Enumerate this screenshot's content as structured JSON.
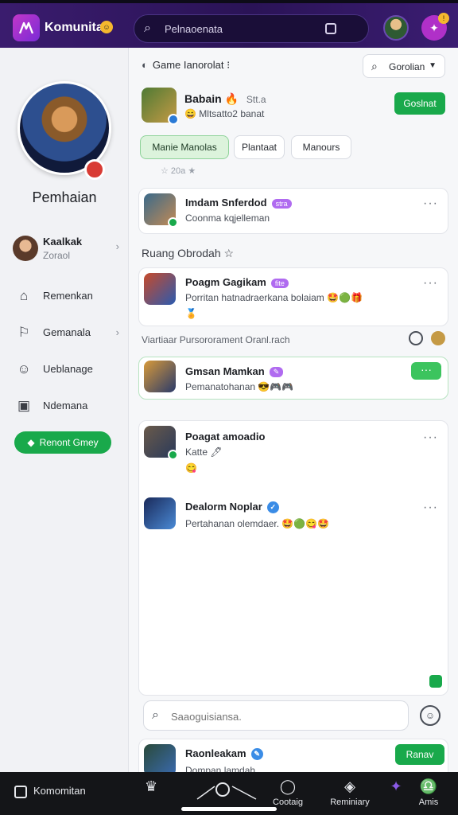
{
  "topbar": {
    "brand": "Komunita",
    "search_text": "Pelnaoenata"
  },
  "sidebar": {
    "profile_name": "Pemhaian",
    "user": {
      "name": "Kaalkak",
      "handle": "Zoraol"
    },
    "nav": [
      {
        "label": "Remenkan",
        "icon": "home-icon",
        "chevron": false
      },
      {
        "label": "Gemanala",
        "icon": "flag-icon",
        "chevron": true
      },
      {
        "label": "Ueblanage",
        "icon": "smile-icon",
        "chevron": false
      },
      {
        "label": "Ndemana",
        "icon": "screen-icon",
        "chevron": false
      }
    ],
    "cta": "Renont Gmey"
  },
  "main": {
    "game_header": "Game Ianorolat",
    "sort_label": "Gorolian",
    "featured": {
      "title": "Babain",
      "subtitle": "Stt.a",
      "desc": "Mltsatto2 banat",
      "button": "Goslnat"
    },
    "chips": [
      "Manie Manolas",
      "Plantaat",
      "Manours"
    ],
    "rating": "☆ 20a ★",
    "section_title": "Ruang Obrodah",
    "thread_label": "Viartiaar Pursororament Oranl.rach",
    "posts": [
      {
        "name": "Imdam Snferdod",
        "tag": "stra",
        "text": "Coonma kqjelleman"
      },
      {
        "name": "Poagm Gagikam",
        "tag": "fite",
        "text": "Porritan hatnadraerkana bolaiam"
      },
      {
        "name": "Gmsan Mamkan",
        "tag": "✎",
        "text": "Pemanatohanan"
      },
      {
        "name": "Poagat amoadio",
        "text": "Katte"
      },
      {
        "name": "Dealorm Noplar",
        "text": "Pertahanan olemdaer."
      },
      {
        "name": "Raonleakam",
        "text": "Dompan lamdah",
        "button": "Ranav"
      }
    ],
    "input_placeholder": "Saaoguisiansa."
  },
  "bottombar": {
    "items": [
      {
        "label": "Komomitan",
        "icon": "square-icon"
      },
      {
        "label": "",
        "icon": "crown-icon"
      },
      {
        "label": "",
        "icon": "home-arc-icon"
      },
      {
        "label": "Cootaig",
        "icon": "chat-icon"
      },
      {
        "label": "Reminiary",
        "icon": "box-icon"
      },
      {
        "label": "Amis",
        "icon": "bell-icon"
      }
    ]
  },
  "colors": {
    "primary": "#19a94b",
    "header": "#2a1356",
    "accent": "#b030c8"
  }
}
